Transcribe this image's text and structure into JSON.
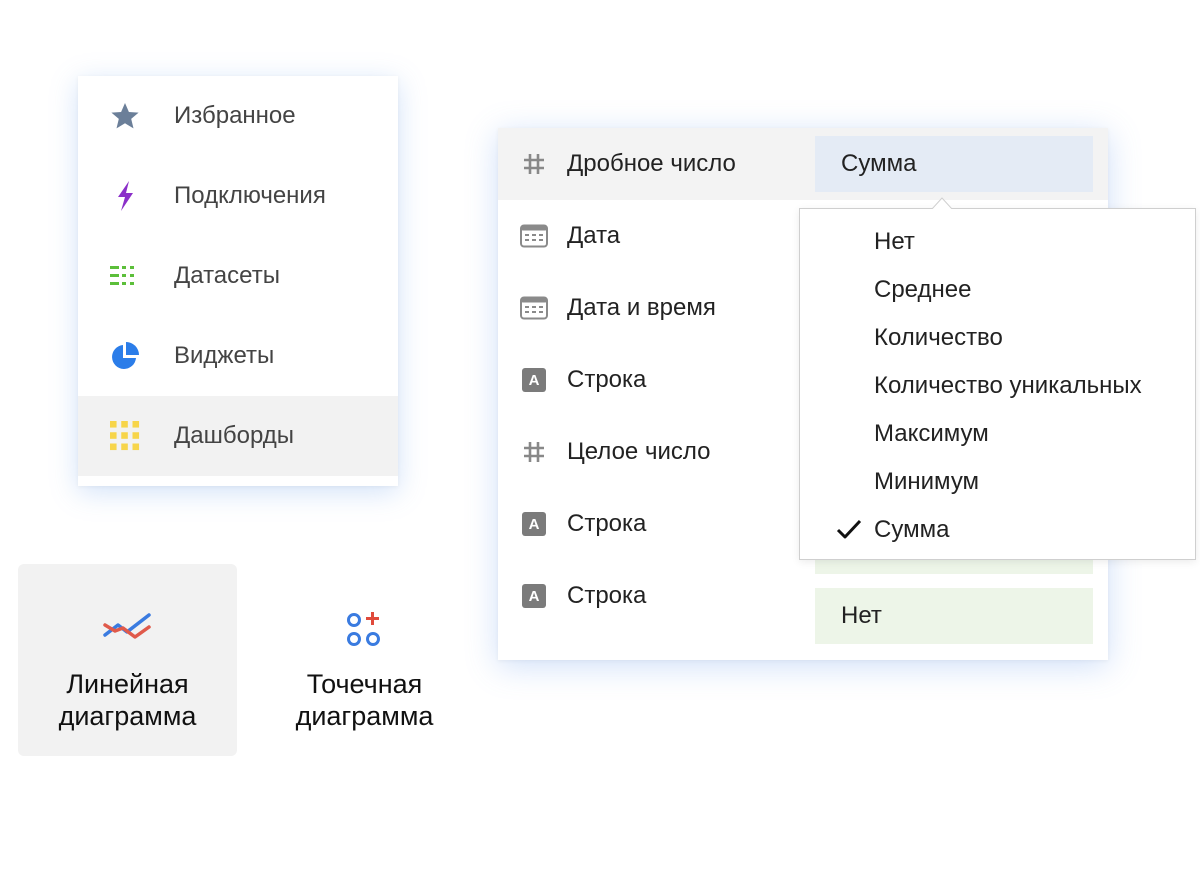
{
  "nav": {
    "items": [
      {
        "label": "Избранное",
        "icon": "star-icon"
      },
      {
        "label": "Подключения",
        "icon": "lightning-icon"
      },
      {
        "label": "Датасеты",
        "icon": "dataset-icon"
      },
      {
        "label": "Виджеты",
        "icon": "pie-chart-icon"
      },
      {
        "label": "Дашборды",
        "icon": "dashboard-grid-icon"
      }
    ],
    "active": "Дашборды"
  },
  "chart_types": [
    {
      "label": "Линейная\nдиаграмма",
      "icon": "line-chart-icon",
      "selected": true
    },
    {
      "label": "Точечная\nдиаграмма",
      "icon": "scatter-chart-icon",
      "selected": false
    }
  ],
  "fields": [
    {
      "label": "Дробное число",
      "type_icon": "hash-icon",
      "aggregation": "Сумма"
    },
    {
      "label": "Дата",
      "type_icon": "calendar-icon"
    },
    {
      "label": "Дата и время",
      "type_icon": "calendar-icon"
    },
    {
      "label": "Строка",
      "type_icon": "string-type-icon",
      "type_letter": "A"
    },
    {
      "label": "Целое число",
      "type_icon": "hash-icon"
    },
    {
      "label": "Строка",
      "type_icon": "string-type-icon",
      "type_letter": "A"
    },
    {
      "label": "Строка",
      "type_icon": "string-type-icon",
      "type_letter": "A",
      "aggregation": "Нет"
    }
  ],
  "dropdown": {
    "options": [
      "Нет",
      "Среднее",
      "Количество",
      "Количество уникальных",
      "Максимум",
      "Минимум",
      "Сумма"
    ],
    "selected": "Сумма"
  },
  "colors": {
    "star": "#6b7f99",
    "lightning": "#8b2fc9",
    "dataset": "#5cbf3a",
    "widget": "#2b7de9",
    "dashboard": "#f7d54a",
    "selected_agg_bg": "#e4ebf5",
    "green_agg_bg": "#edf5e8"
  }
}
